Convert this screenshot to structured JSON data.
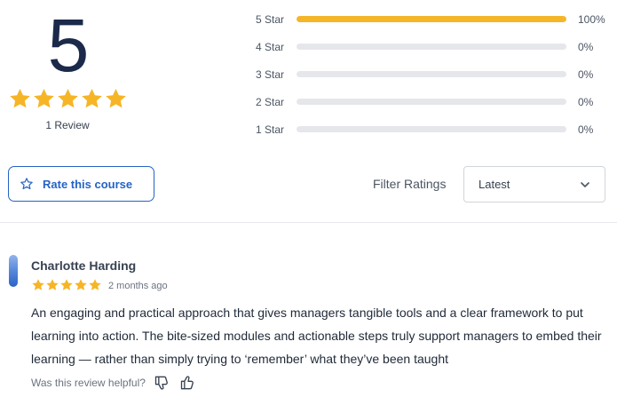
{
  "summary": {
    "average": "5",
    "stars": 5,
    "star_color": "#F6B526",
    "review_count_label": "1 Review"
  },
  "breakdown": [
    {
      "label": "5 Star",
      "percent": 100,
      "percent_label": "100%"
    },
    {
      "label": "4 Star",
      "percent": 0,
      "percent_label": "0%"
    },
    {
      "label": "3 Star",
      "percent": 0,
      "percent_label": "0%"
    },
    {
      "label": "2 Star",
      "percent": 0,
      "percent_label": "0%"
    },
    {
      "label": "1 Star",
      "percent": 0,
      "percent_label": "0%"
    }
  ],
  "toolbar": {
    "rate_button_label": "Rate this course",
    "rate_button_icon": "star-outline-icon",
    "filter_label": "Filter Ratings",
    "filter_selected": "Latest",
    "accent_color": "#2563C4"
  },
  "reviews": [
    {
      "name": "Charlotte Harding",
      "stars": 5,
      "date": "2 months ago",
      "body": "An engaging and practical approach that gives managers tangible tools and a clear framework to put learning into action. The bite-sized modules and actionable steps truly support managers to embed their learning — rather than simply trying to ‘remember’ what they’ve been taught",
      "helpful_label": "Was this review helpful?",
      "icons": [
        "thumbs-down-icon",
        "thumbs-up-icon"
      ]
    }
  ]
}
